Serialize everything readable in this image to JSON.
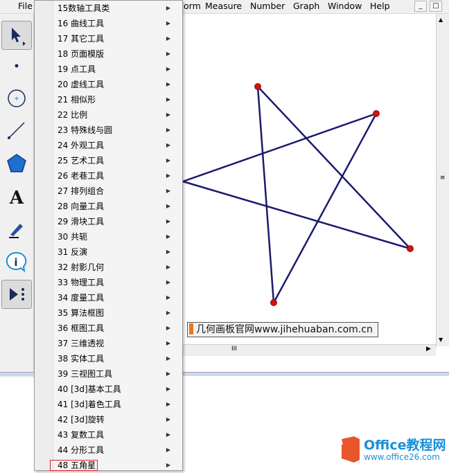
{
  "menubar": {
    "items": [
      "File",
      "orm",
      "Measure",
      "Number",
      "Graph",
      "Window",
      "Help"
    ],
    "controls": [
      "_",
      "□"
    ]
  },
  "toolbar": {
    "tools": [
      "arrow-select",
      "point",
      "compass",
      "straightedge",
      "polygon",
      "text",
      "marker",
      "information",
      "custom"
    ]
  },
  "dropdown": {
    "items": [
      {
        "label": "15数轴工具类"
      },
      {
        "label": "16 曲线工具"
      },
      {
        "label": "17 其它工具"
      },
      {
        "label": "18 页面模版"
      },
      {
        "label": "19 点工具"
      },
      {
        "label": "20 虚线工具"
      },
      {
        "label": "21 相似形"
      },
      {
        "label": "22 比例"
      },
      {
        "label": "23 特殊线与圆"
      },
      {
        "label": "24 外观工具"
      },
      {
        "label": "25 艺术工具"
      },
      {
        "label": "26 老巷工具"
      },
      {
        "label": "27 排列组合"
      },
      {
        "label": "28 向量工具"
      },
      {
        "label": "29 滑块工具"
      },
      {
        "label": "30 共轭"
      },
      {
        "label": "31 反演"
      },
      {
        "label": "32 射影几何"
      },
      {
        "label": "33 物理工具"
      },
      {
        "label": "34 度量工具"
      },
      {
        "label": "35 算法框图"
      },
      {
        "label": "36 框图工具"
      },
      {
        "label": "37 三维透视"
      },
      {
        "label": "38 实体工具"
      },
      {
        "label": "39 三视图工具"
      },
      {
        "label": "40 [3d]基本工具"
      },
      {
        "label": "41 [3d]着色工具"
      },
      {
        "label": "42 [3d]旋转"
      },
      {
        "label": "43 复数工具"
      },
      {
        "label": "44 分形工具"
      },
      {
        "label": "48 五角星"
      }
    ],
    "highlighted_index": 30
  },
  "canvas": {
    "star_color": "#1a1a6e",
    "point_color": "#d41010"
  },
  "watermark": {
    "text": "几何画板官网www.jihehuaban.com.cn"
  },
  "logo": {
    "brand": "Office教程网",
    "url": "www.office26.com"
  },
  "scrollbar": {
    "grip": "III"
  }
}
